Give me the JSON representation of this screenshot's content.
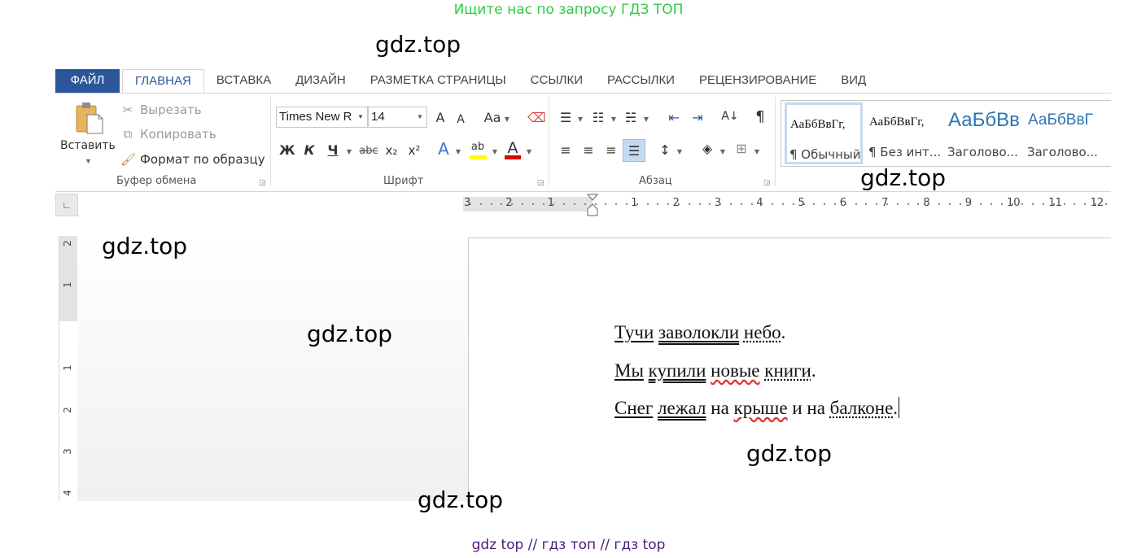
{
  "promo": {
    "top": "Ищите нас по запросу ГДЗ ТОП",
    "bottom": "gdz top  //  гдз топ  //  гдз top",
    "watermark": "gdz.top"
  },
  "tabs": [
    "ФАЙЛ",
    "ГЛАВНАЯ",
    "ВСТАВКА",
    "ДИЗАЙН",
    "РАЗМЕТКА СТРАНИЦЫ",
    "ССЫЛКИ",
    "РАССЫЛКИ",
    "РЕЦЕНЗИРОВАНИЕ",
    "ВИД"
  ],
  "active_tab": "ГЛАВНАЯ",
  "clipboard": {
    "paste_label": "Вставить",
    "cut_label": "Вырезать",
    "copy_label": "Копировать",
    "format_painter_label": "Формат по образцу",
    "group_label": "Буфер обмена"
  },
  "font": {
    "font_name": "Times New R",
    "font_size": "14",
    "bold": "Ж",
    "italic": "К",
    "underline": "Ч",
    "strike": "abc",
    "subscript": "x₂",
    "superscript": "x²",
    "grow": "A",
    "shrink": "A",
    "case": "Aa",
    "group_label": "Шрифт"
  },
  "paragraph": {
    "group_label": "Абзац",
    "pilcrow": "¶"
  },
  "styles": [
    {
      "sample": "АаБбВвГг,",
      "name": "¶ Обычный"
    },
    {
      "sample": "АаБбВвГг,",
      "name": "¶ Без инт..."
    },
    {
      "sample": "АаБбВв",
      "name": "Заголово..."
    },
    {
      "sample": "АаБбВвГ",
      "name": "Заголово..."
    }
  ],
  "ruler": {
    "corner": "∟",
    "h_ticks": [
      "3",
      "2",
      "1",
      "1",
      "2",
      "3",
      "4",
      "5",
      "6",
      "7",
      "8",
      "9",
      "10",
      "11",
      "12"
    ],
    "v_ticks": [
      "2",
      "1",
      "1",
      "2",
      "3",
      "4"
    ]
  },
  "document": {
    "line1": {
      "w1": "Тучи",
      "w2": "заволокли",
      "w3": "небо",
      "end": "."
    },
    "line2": {
      "w1": "Мы",
      "w2": "купили",
      "w3": "новые",
      "w4": "книги",
      "end": "."
    },
    "line3": {
      "w1": "Снег",
      "w2": "лежал",
      "w3": " на ",
      "w4": "крыше",
      "w5": " и на ",
      "w6": "балконе",
      "end": "."
    }
  },
  "colors": {
    "file_tab": "#2b579a",
    "highlight": "#ffff00",
    "font_color": "#e00000",
    "promo_top": "#2ecc40",
    "promo_bottom": "#4b1a7a"
  }
}
